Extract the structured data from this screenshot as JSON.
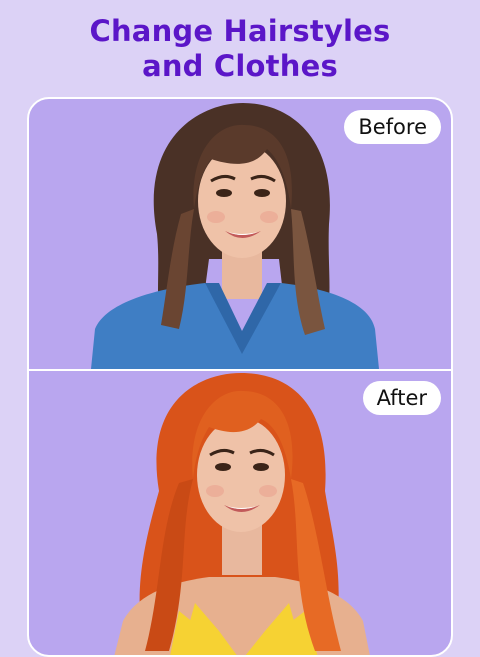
{
  "headline": {
    "line1": "Change Hairstyles",
    "line2": "and Clothes"
  },
  "comparison": {
    "before_label": "Before",
    "after_label": "After"
  },
  "colors": {
    "background": "#dcd2f6",
    "headline": "#5b16c8",
    "panel": "#b9a6ef",
    "before_hair": "#4a3126",
    "before_top": "#3f7ec4",
    "after_hair": "#d9531a",
    "after_top": "#f6d233"
  }
}
